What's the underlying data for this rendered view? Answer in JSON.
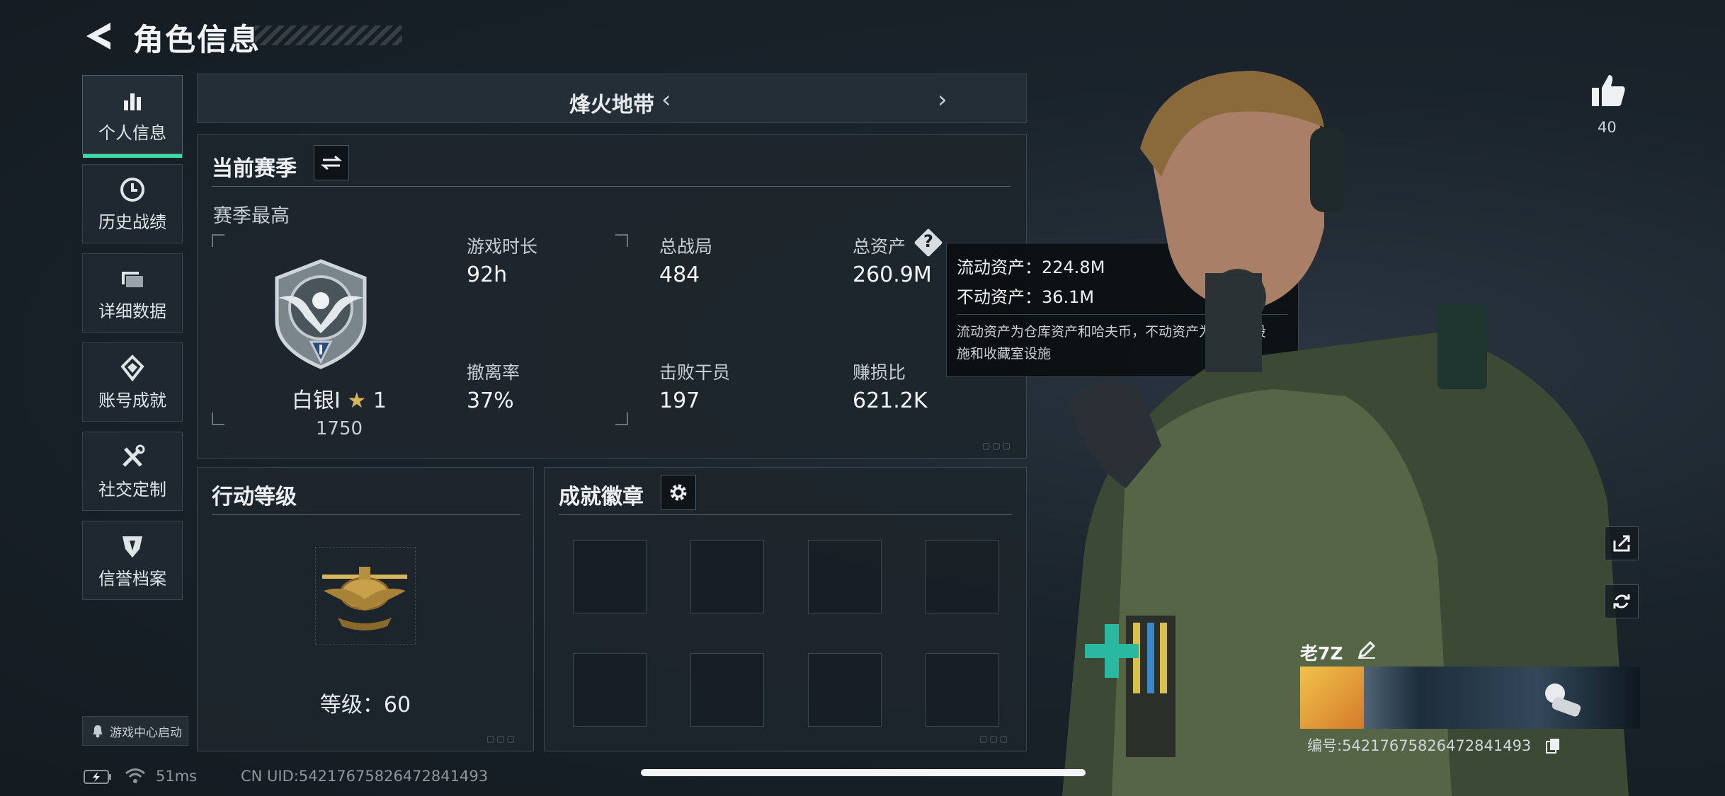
{
  "header": {
    "title": "角色信息"
  },
  "nav": [
    {
      "label": "个人信息",
      "icon": "bar-chart-icon",
      "active": true
    },
    {
      "label": "历史战绩",
      "icon": "clock-icon",
      "active": false
    },
    {
      "label": "详细数据",
      "icon": "folder-icon",
      "active": false
    },
    {
      "label": "账号成就",
      "icon": "medal-icon",
      "active": false
    },
    {
      "label": "社交定制",
      "icon": "tools-icon",
      "active": false
    },
    {
      "label": "信誉档案",
      "icon": "shield-icon",
      "active": false
    }
  ],
  "game_center": {
    "label": "游戏中心启动"
  },
  "mode": {
    "name": "烽火地带"
  },
  "season": {
    "title": "当前赛季",
    "subtitle": "赛季最高",
    "rank_name": "白银I",
    "rank_stars": "1",
    "rank_score": "1750",
    "stats": [
      {
        "label": "游戏时长",
        "value": "92h"
      },
      {
        "label": "总战局",
        "value": "484"
      },
      {
        "label": "总资产",
        "value": "260.9M"
      },
      {
        "label": "撤离率",
        "value": "37%"
      },
      {
        "label": "击败干员",
        "value": "197"
      },
      {
        "label": "赚损比",
        "value": "621.2K"
      }
    ]
  },
  "tooltip": {
    "liquid": "流动资产：224.8M",
    "fixed": "不动资产：36.1M",
    "desc_line1": "流动资产为仓库资产和哈夫币，不动资产为特勤处设",
    "desc_line2": "施和收藏室设施"
  },
  "action_level": {
    "title": "行动等级",
    "level_text": "等级：60"
  },
  "achievements": {
    "title": "成就徽章"
  },
  "status_bar": {
    "latency": "51ms",
    "uid": "CN UID:542176758264728414​93"
  },
  "player": {
    "like_count": "40",
    "name": "老7Z",
    "id": "编号:54217675826472841493"
  },
  "colors": {
    "accent": "#3de0a4",
    "panel_bg": "#1e262d",
    "gold": "#d8b45a"
  }
}
